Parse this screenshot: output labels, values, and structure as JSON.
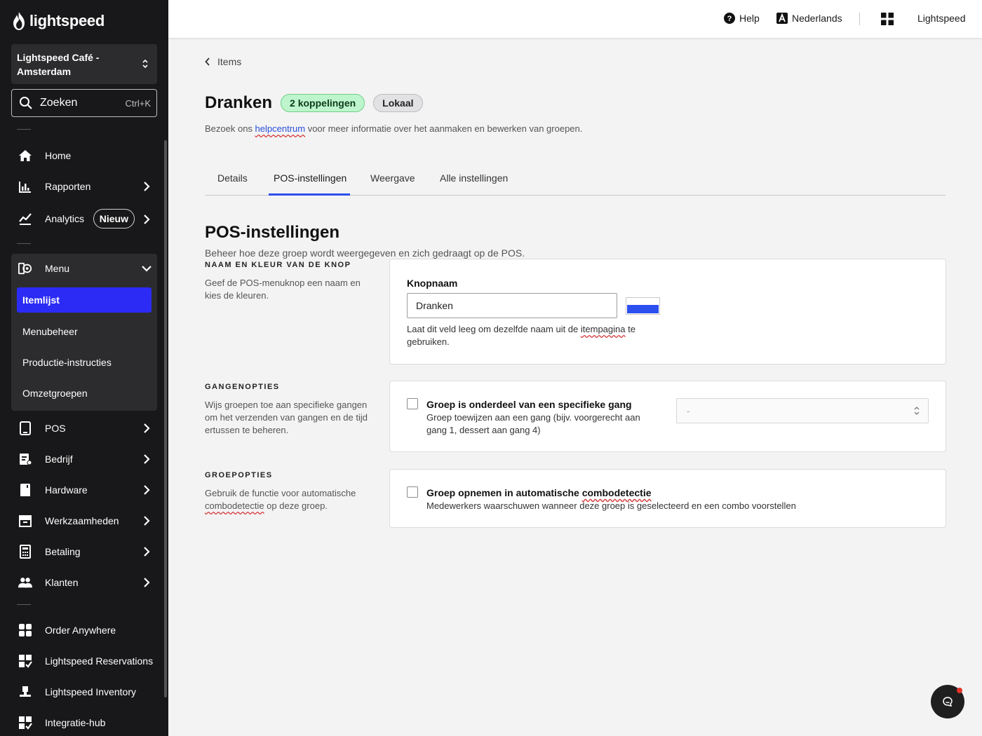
{
  "brand": {
    "logo_text": "lightspeed"
  },
  "sidebar": {
    "location": "Lightspeed Café - Amsterdam",
    "search_label": "Zoeken",
    "search_shortcut": "Ctrl+K",
    "items": [
      {
        "label": "Home",
        "icon": "home-icon"
      },
      {
        "label": "Rapporten",
        "icon": "bar-chart-icon"
      },
      {
        "label": "Analytics",
        "icon": "trend-icon",
        "badge": "Nieuw"
      },
      {
        "label": "Menu",
        "icon": "menu-book-icon"
      },
      {
        "label": "POS",
        "icon": "tablet-icon"
      },
      {
        "label": "Bedrijf",
        "icon": "business-icon"
      },
      {
        "label": "Hardware",
        "icon": "hardware-icon"
      },
      {
        "label": "Werkzaamheden",
        "icon": "archive-icon"
      },
      {
        "label": "Betaling",
        "icon": "calculator-icon"
      },
      {
        "label": "Klanten",
        "icon": "customers-icon"
      },
      {
        "label": "Order Anywhere",
        "icon": "order-icon"
      },
      {
        "label": "Lightspeed Reservations",
        "icon": "reservations-icon"
      },
      {
        "label": "Lightspeed Inventory",
        "icon": "inventory-icon"
      },
      {
        "label": "Integratie-hub",
        "icon": "integration-icon"
      }
    ],
    "menu_sub": [
      "Itemlijst",
      "Menubeheer",
      "Productie-instructies",
      "Omzetgroepen"
    ]
  },
  "topbar": {
    "help": "Help",
    "language": "Nederlands",
    "account": "Lightspeed"
  },
  "page": {
    "back_label": "Items",
    "title": "Dranken",
    "badge_links": "2 koppelingen",
    "badge_local": "Lokaal",
    "subtitle_pre": "Bezoek ons ",
    "subtitle_link": "helpcentrum",
    "subtitle_post": " voor meer informatie over het aanmaken en bewerken van groepen.",
    "tabs": [
      "Details",
      "POS-instellingen",
      "Weergave",
      "Alle instellingen"
    ],
    "active_tab": "POS-instellingen"
  },
  "pos": {
    "title": "POS-instellingen",
    "description": "Beheer hoe deze groep wordt weergegeven en zich gedraagt op de POS.",
    "button_section": {
      "heading": "NAAM EN KLEUR VAN DE KNOP",
      "desc": "Geef de POS-menuknop een naam en kies de kleuren.",
      "field_label": "Knopnaam",
      "value": "Dranken",
      "swatch_color": "#2c50f0",
      "hint_pre": "Laat dit veld leeg om dezelfde naam uit de ",
      "hint_link": "itempagina",
      "hint_post": " te gebruiken."
    },
    "courses": {
      "heading": "GANGENOPTIES",
      "desc": "Wijs groepen toe aan specifieke gangen om het verzenden van gangen en de tijd ertussen te beheren.",
      "checkbox_title": "Groep is onderdeel van een specifieke gang",
      "checkbox_desc": "Groep toewijzen aan een gang (bijv. voorgerecht aan gang 1, dessert aan gang 4)",
      "select_value": "-"
    },
    "group": {
      "heading": "GROEPOPTIES",
      "desc_pre": "Gebruik de functie voor automatische ",
      "desc_link": "combodetectie",
      "desc_post": " op deze groep.",
      "checkbox_title_pre": "Groep opnemen in automatische ",
      "checkbox_title_link": "combodetectie",
      "checkbox_desc": "Medewerkers waarschuwen wanneer deze groep is geselecteerd en een combo voorstellen"
    }
  }
}
